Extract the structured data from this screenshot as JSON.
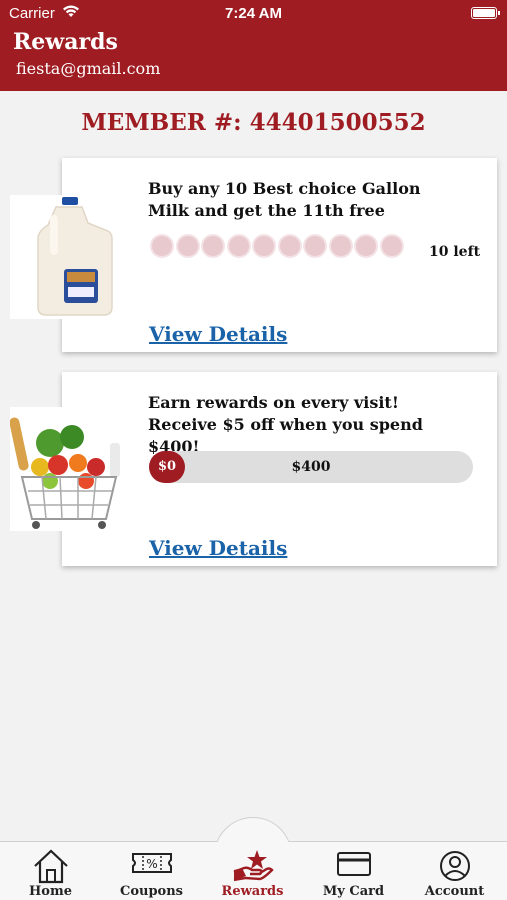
{
  "status_bar": {
    "carrier": "Carrier",
    "time": "7:24 AM"
  },
  "header": {
    "title": "Rewards",
    "email": "fiesta@gmail.com"
  },
  "member": {
    "label": "MEMBER #:",
    "number": "44401500552"
  },
  "rewards": [
    {
      "description": "Buy any 10 Best choice Gallon Milk and get the 11th free",
      "punches_total": 10,
      "punches_filled": 0,
      "left_text": "10 left",
      "link": "View Details",
      "image_icon": "milk-gallon-image"
    },
    {
      "description": "Earn rewards on every visit! Receive $5 off when you spend $400!",
      "progress_start": "$0",
      "progress_end": "$400",
      "progress_fraction": 0,
      "link": "View Details",
      "image_icon": "grocery-basket-image"
    }
  ],
  "tabs": [
    {
      "label": "Home",
      "icon": "home-icon"
    },
    {
      "label": "Coupons",
      "icon": "coupon-icon"
    },
    {
      "label": "Rewards",
      "icon": "rewards-hand-star-icon",
      "active": true
    },
    {
      "label": "My Card",
      "icon": "card-icon"
    },
    {
      "label": "Account",
      "icon": "account-icon"
    }
  ],
  "colors": {
    "brand": "#9e1c22",
    "link": "#1b63a8",
    "punch": "#e8c9ce",
    "background": "#f2f2f2"
  }
}
